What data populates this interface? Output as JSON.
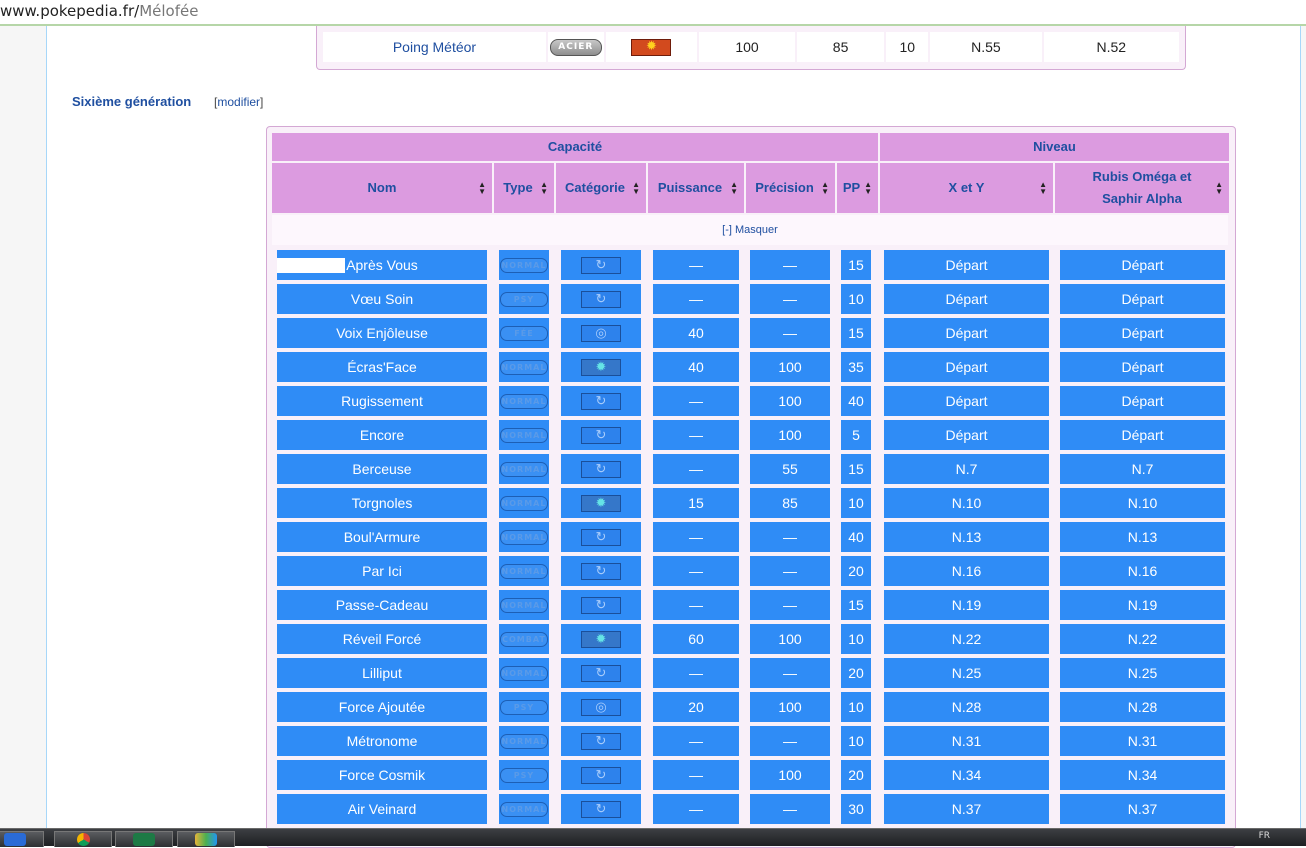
{
  "browser": {
    "url_host": "www.pokepedia.fr/",
    "url_path": "Mélofée"
  },
  "previous_table": {
    "row": {
      "name": "Poing Météor",
      "type": "ACIER",
      "category": "physical",
      "power": "100",
      "accuracy": "85",
      "pp": "10",
      "level_a": "N.55",
      "level_b": "N.52"
    }
  },
  "section": {
    "title": "Sixième génération",
    "edit_open": "[",
    "edit_label": "modifier",
    "edit_close": "]"
  },
  "table": {
    "header_group_capacity": "Capacité",
    "header_group_level": "Niveau",
    "columns": {
      "name": "Nom",
      "type": "Type",
      "category": "Catégorie",
      "power": "Puissance",
      "accuracy": "Précision",
      "pp": "PP",
      "xy": "X et Y",
      "roas_line1": "Rubis Oméga et",
      "roas_line2": "Saphir Alpha"
    },
    "toggle_label": "[-] Masquer",
    "rows": [
      {
        "name": "Après Vous",
        "type": "NORMAL",
        "cat": "status",
        "power": "—",
        "acc": "—",
        "pp": "15",
        "xy": "Départ",
        "roas": "Départ"
      },
      {
        "name": "Vœu Soin",
        "type": "PSY",
        "cat": "status",
        "power": "—",
        "acc": "—",
        "pp": "10",
        "xy": "Départ",
        "roas": "Départ"
      },
      {
        "name": "Voix Enjôleuse",
        "type": "FÉE",
        "cat": "special",
        "power": "40",
        "acc": "—",
        "pp": "15",
        "xy": "Départ",
        "roas": "Départ"
      },
      {
        "name": "Écras'Face",
        "type": "NORMAL",
        "cat": "physical",
        "power": "40",
        "acc": "100",
        "pp": "35",
        "xy": "Départ",
        "roas": "Départ"
      },
      {
        "name": "Rugissement",
        "type": "NORMAL",
        "cat": "status",
        "power": "—",
        "acc": "100",
        "pp": "40",
        "xy": "Départ",
        "roas": "Départ"
      },
      {
        "name": "Encore",
        "type": "NORMAL",
        "cat": "status",
        "power": "—",
        "acc": "100",
        "pp": "5",
        "xy": "Départ",
        "roas": "Départ"
      },
      {
        "name": "Berceuse",
        "type": "NORMAL",
        "cat": "status",
        "power": "—",
        "acc": "55",
        "pp": "15",
        "xy": "N.7",
        "roas": "N.7"
      },
      {
        "name": "Torgnoles",
        "type": "NORMAL",
        "cat": "physical",
        "power": "15",
        "acc": "85",
        "pp": "10",
        "xy": "N.10",
        "roas": "N.10"
      },
      {
        "name": "Boul'Armure",
        "type": "NORMAL",
        "cat": "status",
        "power": "—",
        "acc": "—",
        "pp": "40",
        "xy": "N.13",
        "roas": "N.13"
      },
      {
        "name": "Par Ici",
        "type": "NORMAL",
        "cat": "status",
        "power": "—",
        "acc": "—",
        "pp": "20",
        "xy": "N.16",
        "roas": "N.16"
      },
      {
        "name": "Passe-Cadeau",
        "type": "NORMAL",
        "cat": "status",
        "power": "—",
        "acc": "—",
        "pp": "15",
        "xy": "N.19",
        "roas": "N.19"
      },
      {
        "name": "Réveil Forcé",
        "type": "COMBAT",
        "cat": "physical",
        "power": "60",
        "acc": "100",
        "pp": "10",
        "xy": "N.22",
        "roas": "N.22"
      },
      {
        "name": "Lilliput",
        "type": "NORMAL",
        "cat": "status",
        "power": "—",
        "acc": "—",
        "pp": "20",
        "xy": "N.25",
        "roas": "N.25"
      },
      {
        "name": "Force Ajoutée",
        "type": "PSY",
        "cat": "special",
        "power": "20",
        "acc": "100",
        "pp": "10",
        "xy": "N.28",
        "roas": "N.28"
      },
      {
        "name": "Métronome",
        "type": "NORMAL",
        "cat": "status",
        "power": "—",
        "acc": "—",
        "pp": "10",
        "xy": "N.31",
        "roas": "N.31"
      },
      {
        "name": "Force Cosmik",
        "type": "PSY",
        "cat": "status",
        "power": "—",
        "acc": "100",
        "pp": "20",
        "xy": "N.34",
        "roas": "N.34"
      },
      {
        "name": "Air Veinard",
        "type": "NORMAL",
        "cat": "status",
        "power": "—",
        "acc": "—",
        "pp": "30",
        "xy": "N.37",
        "roas": "N.37"
      }
    ]
  },
  "taskbar": {
    "apps": [
      "windows-media-icon",
      "chrome-icon",
      "excel-icon",
      "paint-icon"
    ],
    "tray_text": "FR"
  },
  "colors": {
    "header_bg": "#dc9be0",
    "row_bg": "#2f8cf6",
    "link": "#1f4fa0"
  }
}
